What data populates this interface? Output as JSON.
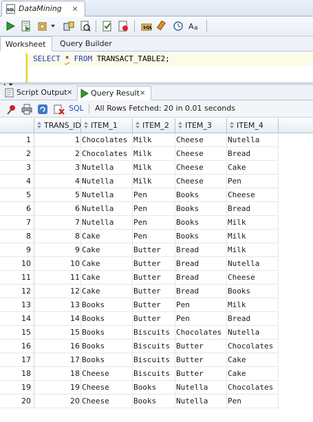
{
  "document_tab": {
    "title": "DataMining",
    "icon": "sql-file-icon",
    "close": "×"
  },
  "toolbar": {
    "buttons": [
      "run-statement-icon",
      "run-script-icon",
      "commit-icon",
      "rollback-icon",
      "autotrace-icon",
      "explain-plan-icon",
      "sql-tuning-icon",
      "unshared-sql-icon",
      "clear-icon",
      "sql-history-icon",
      "format-icon"
    ]
  },
  "subtabs": {
    "worksheet": "Worksheet",
    "query_builder": "Query Builder"
  },
  "editor": {
    "keyword_select": "SELECT",
    "star": "*",
    "keyword_from": "FROM",
    "rest": "TRANSACT_TABLE2;"
  },
  "result_tabs": {
    "script_output": "Script Output",
    "query_result": "Query Result",
    "close": "×"
  },
  "result_toolbar": {
    "sql_link": "SQL",
    "status": "All Rows Fetched: 20 in 0.01 seconds"
  },
  "grid": {
    "columns": [
      "TRANS_ID",
      "ITEM_1",
      "ITEM_2",
      "ITEM_3",
      "ITEM_4"
    ],
    "rows": [
      [
        "1",
        "1",
        "Chocolates",
        "Milk",
        "Cheese",
        "Nutella"
      ],
      [
        "2",
        "2",
        "Chocolates",
        "Milk",
        "Cheese",
        "Bread"
      ],
      [
        "3",
        "3",
        "Nutella",
        "Milk",
        "Cheese",
        "Cake"
      ],
      [
        "4",
        "4",
        "Nutella",
        "Milk",
        "Cheese",
        "Pen"
      ],
      [
        "5",
        "5",
        "Nutella",
        "Pen",
        "Books",
        "Cheese"
      ],
      [
        "6",
        "6",
        "Nutella",
        "Pen",
        "Books",
        "Bread"
      ],
      [
        "7",
        "7",
        "Nutella",
        "Pen",
        "Books",
        "Milk"
      ],
      [
        "8",
        "8",
        "Cake",
        "Pen",
        "Books",
        "Milk"
      ],
      [
        "9",
        "9",
        "Cake",
        "Butter",
        "Bread",
        "Milk"
      ],
      [
        "10",
        "10",
        "Cake",
        "Butter",
        "Bread",
        "Nutella"
      ],
      [
        "11",
        "11",
        "Cake",
        "Butter",
        "Bread",
        "Cheese"
      ],
      [
        "12",
        "12",
        "Cake",
        "Butter",
        "Bread",
        "Books"
      ],
      [
        "13",
        "13",
        "Books",
        "Butter",
        "Pen",
        "Milk"
      ],
      [
        "14",
        "14",
        "Books",
        "Butter",
        "Pen",
        "Bread"
      ],
      [
        "15",
        "15",
        "Books",
        "Biscuits",
        "Chocolates",
        "Nutella"
      ],
      [
        "16",
        "16",
        "Books",
        "Biscuits",
        "Butter",
        "Chocolates"
      ],
      [
        "17",
        "17",
        "Books",
        "Biscuits",
        "Butter",
        "Cake"
      ],
      [
        "18",
        "18",
        "Cheese",
        "Biscuits",
        "Butter",
        "Cake"
      ],
      [
        "19",
        "19",
        "Cheese",
        "Books",
        "Nutella",
        "Chocolates"
      ],
      [
        "20",
        "20",
        "Cheese",
        "Books",
        "Nutella",
        "Pen"
      ]
    ]
  },
  "colors": {
    "keyword": "#1a3fc8",
    "link": "#1f4fb4",
    "current_line": "#fbfbe8"
  }
}
